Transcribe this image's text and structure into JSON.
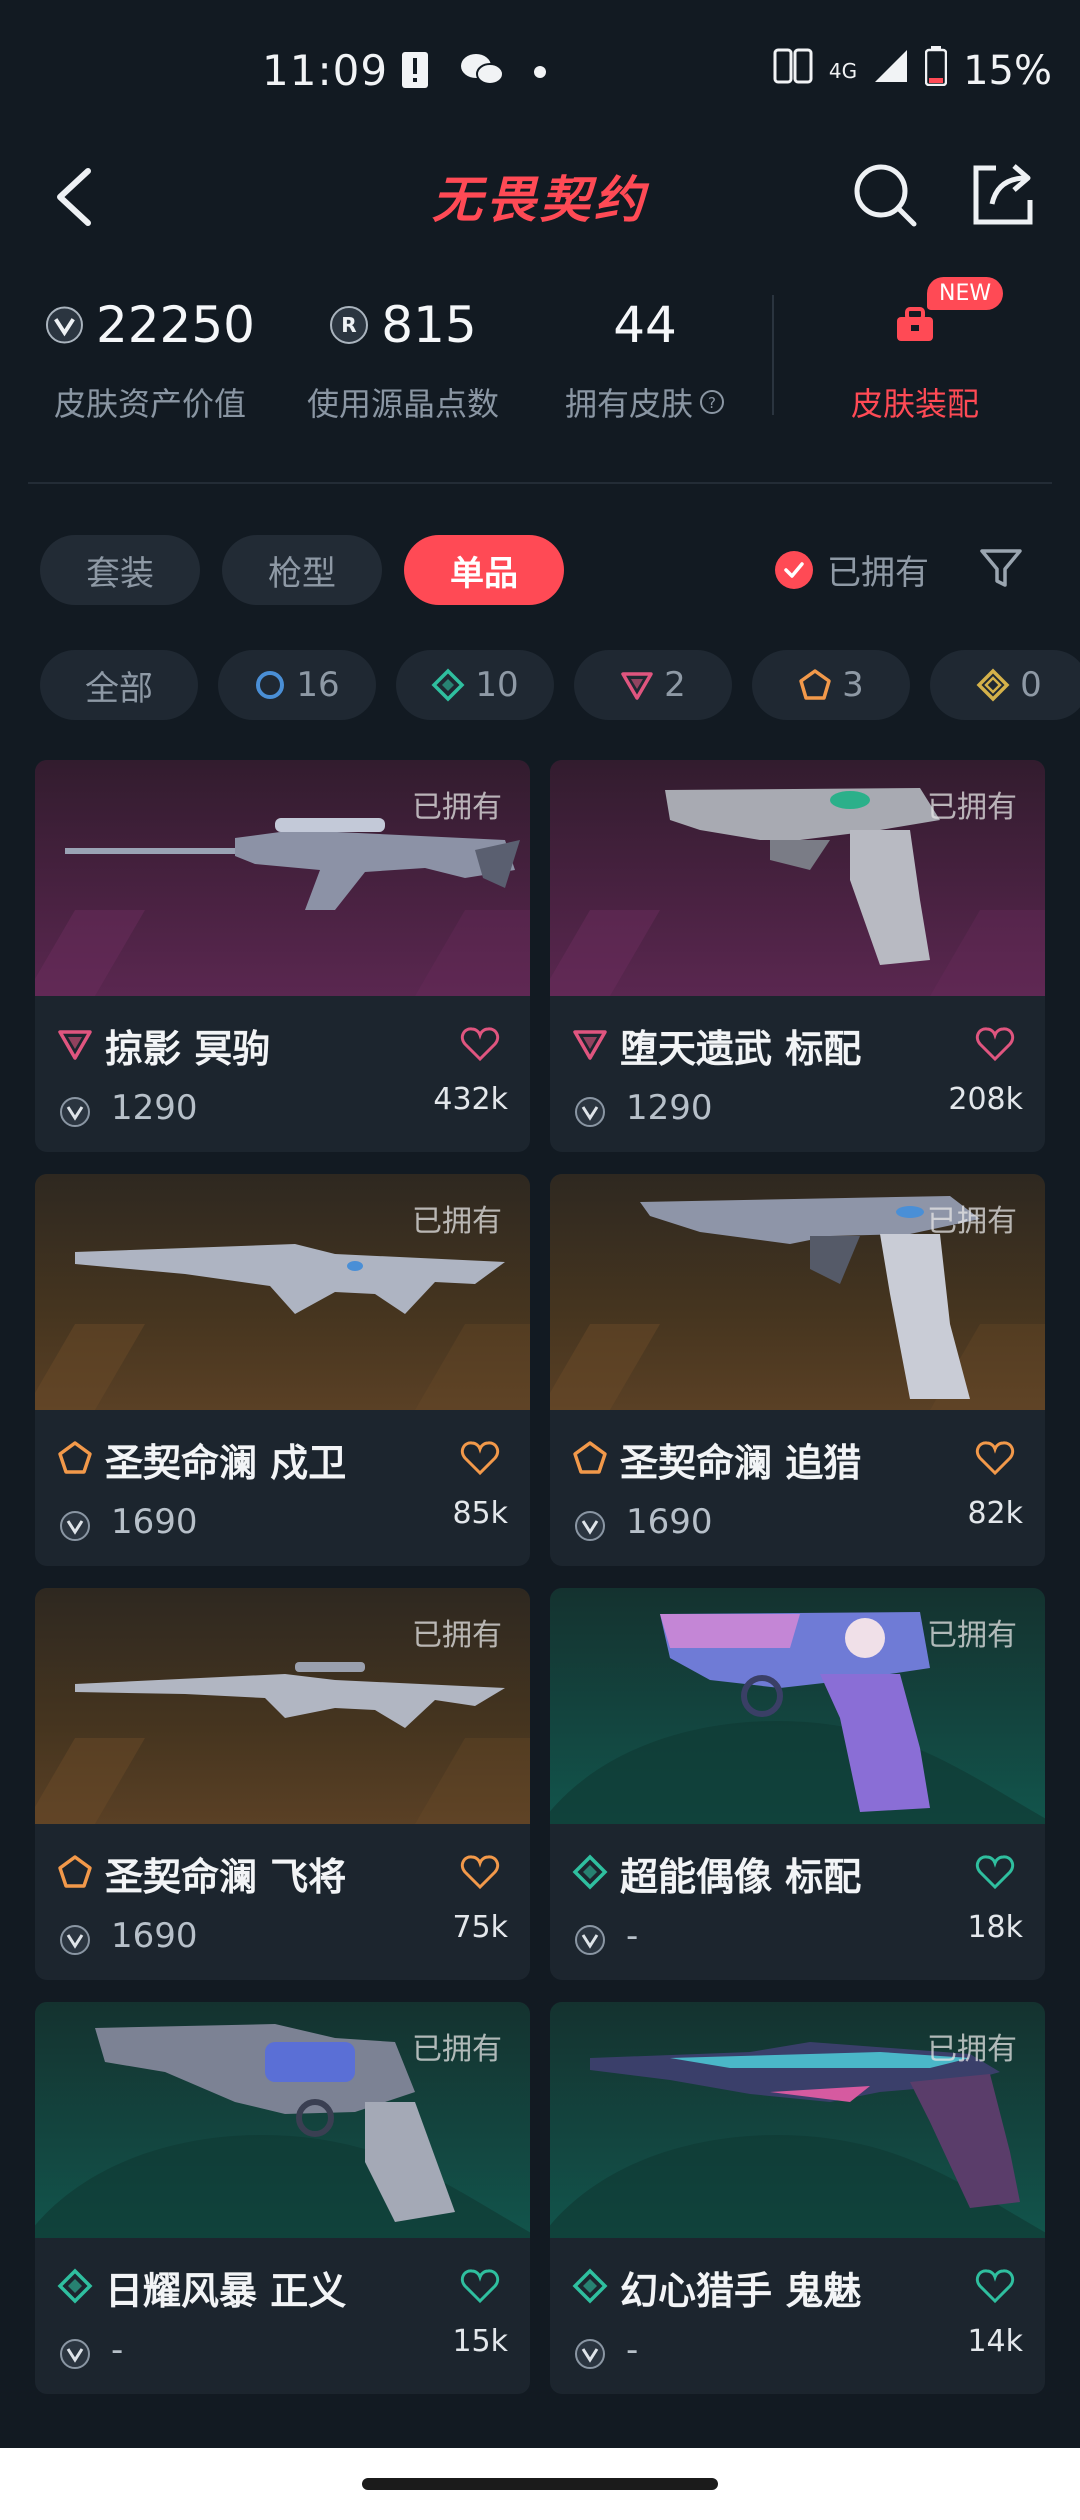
{
  "status_bar": {
    "time": "11:09",
    "network": "4G",
    "battery": "15%"
  },
  "header": {
    "title": "无畏契约",
    "back_icon": "chevron-left-icon",
    "search_icon": "search-icon",
    "share_icon": "share-icon"
  },
  "stats": {
    "asset_value": "22250",
    "asset_value_label": "皮肤资产价值",
    "radianite_points": "815",
    "radianite_points_label": "使用源晶点数",
    "owned_skins": "44",
    "owned_skins_label": "拥有皮肤",
    "wardrobe_label": "皮肤装配",
    "new_badge": "NEW"
  },
  "tabs": [
    {
      "label": "套装",
      "active": false
    },
    {
      "label": "枪型",
      "active": false
    },
    {
      "label": "单品",
      "active": true
    }
  ],
  "owned_filter_label": "已拥有",
  "chips": {
    "all": "全部",
    "select": "16",
    "deluxe": "10",
    "premium": "2",
    "ultra": "3",
    "exclusive": "0"
  },
  "owned_tag": "已拥有",
  "cards": [
    {
      "name": "掠影 冥驹",
      "price": "1290",
      "likes": "432k",
      "theme": "purple",
      "rarity_color": "#e0557f"
    },
    {
      "name": "堕天遗武 标配",
      "price": "1290",
      "likes": "208k",
      "theme": "purple",
      "rarity_color": "#e0557f"
    },
    {
      "name": "圣契命澜 戍卫",
      "price": "1690",
      "likes": "85k",
      "theme": "orange",
      "rarity_color": "#f2994a"
    },
    {
      "name": "圣契命澜 追猎",
      "price": "1690",
      "likes": "82k",
      "theme": "orange",
      "rarity_color": "#f2994a"
    },
    {
      "name": "圣契命澜 飞将",
      "price": "1690",
      "likes": "75k",
      "theme": "orange",
      "rarity_color": "#f2994a"
    },
    {
      "name": "超能偶像 标配",
      "price": "-",
      "likes": "18k",
      "theme": "green",
      "rarity_color": "#2fbf9f"
    },
    {
      "name": "日耀风暴 正义",
      "price": "-",
      "likes": "15k",
      "theme": "green",
      "rarity_color": "#2fbf9f"
    },
    {
      "name": "幻心猎手 鬼魅",
      "price": "-",
      "likes": "14k",
      "theme": "green",
      "rarity_color": "#2fbf9f"
    }
  ],
  "colors": {
    "accent": "#ff4a55",
    "background": "#121a22"
  }
}
